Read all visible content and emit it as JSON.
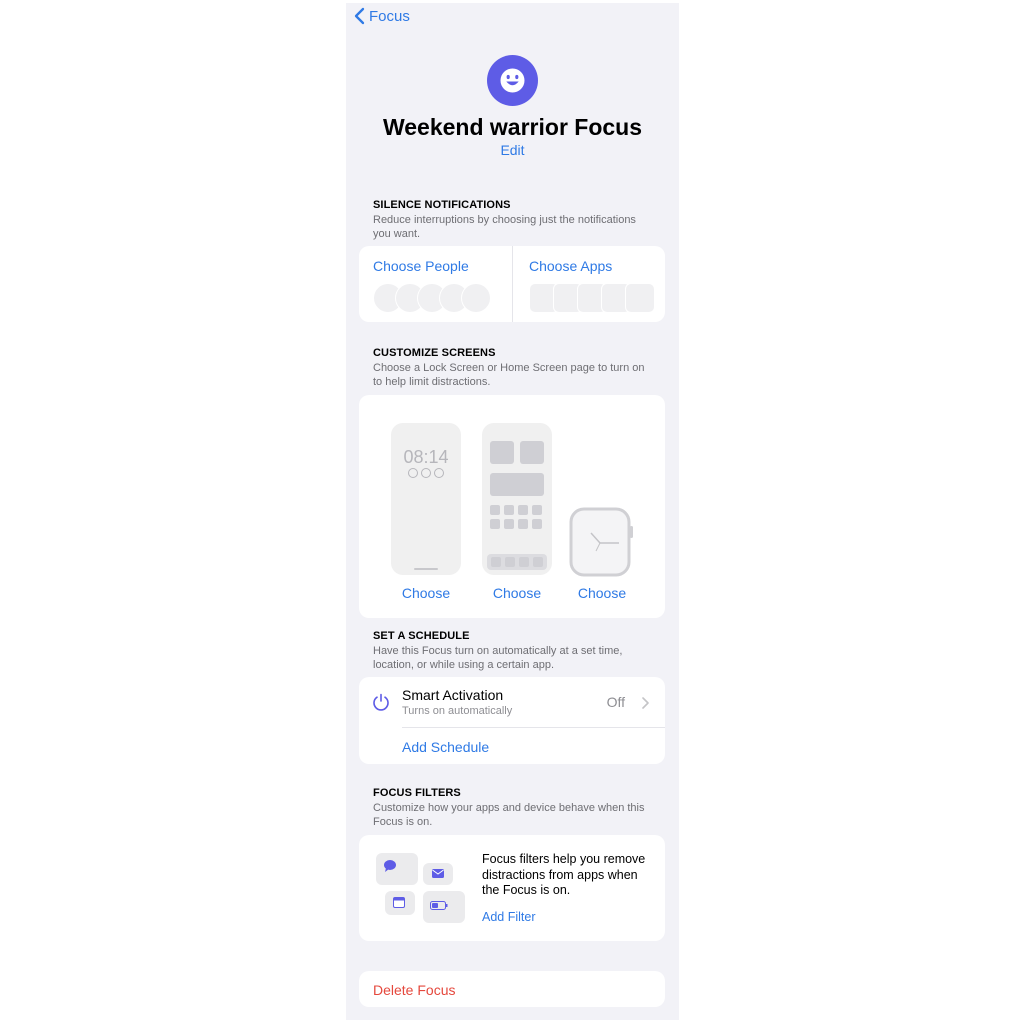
{
  "nav": {
    "back_label": "Focus"
  },
  "header": {
    "title": "Weekend warrior Focus",
    "edit_label": "Edit"
  },
  "silence": {
    "heading": "SILENCE NOTIFICATIONS",
    "description": "Reduce interruptions by choosing just the notifications you want.",
    "choose_people": "Choose People",
    "choose_apps": "Choose Apps"
  },
  "screens": {
    "heading": "CUSTOMIZE SCREENS",
    "description": "Choose a Lock Screen or Home Screen page to turn on to help limit distractions.",
    "lock_time": "08:14",
    "choose_labels": [
      "Choose",
      "Choose",
      "Choose"
    ]
  },
  "schedule": {
    "heading": "SET A SCHEDULE",
    "description": "Have this Focus turn on automatically at a set time, location, or while using a certain app.",
    "smart_title": "Smart Activation",
    "smart_subtitle": "Turns on automatically",
    "smart_value": "Off",
    "add_schedule": "Add Schedule"
  },
  "filters": {
    "heading": "FOCUS FILTERS",
    "description": "Customize how your apps and device behave when this Focus is on.",
    "body": "Focus filters help you remove distractions from apps when the Focus is on.",
    "add_filter": "Add Filter"
  },
  "delete_label": "Delete Focus",
  "colors": {
    "accent": "#2f7ae5",
    "focus_purple": "#5e5ce6",
    "destructive": "#e5483d",
    "background": "#f2f2f7"
  }
}
